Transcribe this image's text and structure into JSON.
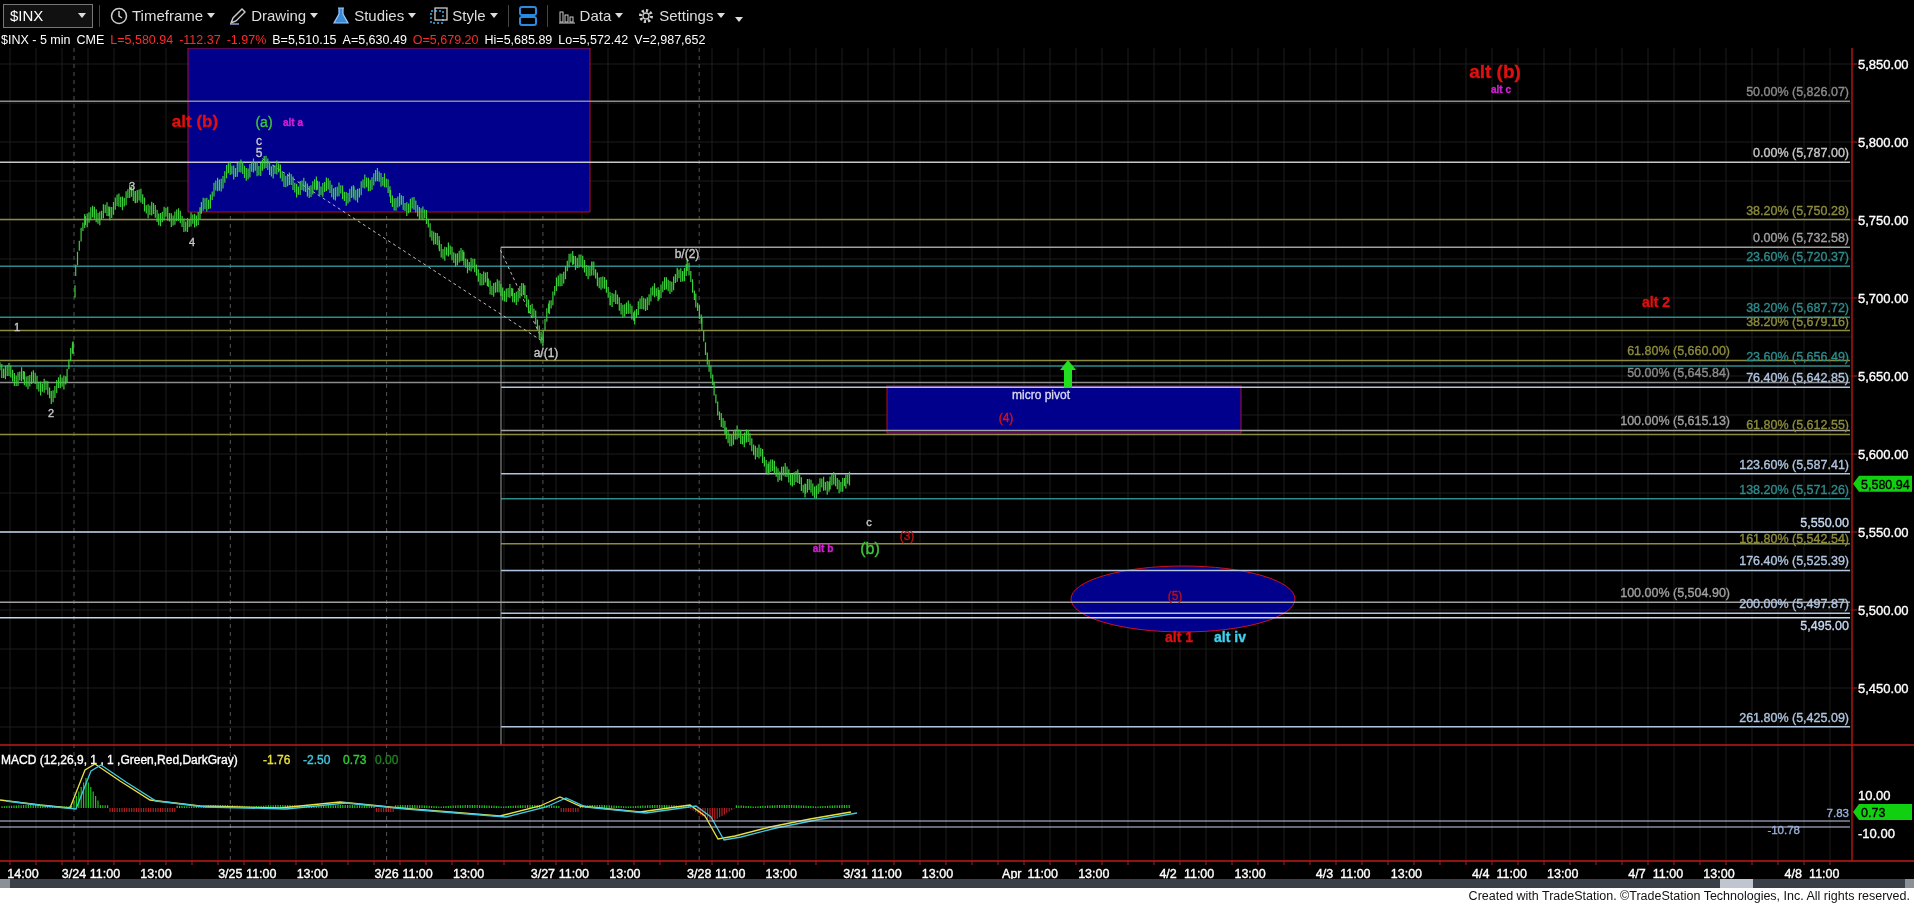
{
  "toolbar": {
    "symbol": "$INX",
    "menus": [
      {
        "kind": "timeframe",
        "label": "Timeframe"
      },
      {
        "kind": "drawing",
        "label": "Drawing"
      },
      {
        "kind": "studies",
        "label": "Studies"
      },
      {
        "kind": "style",
        "label": "Style"
      },
      {
        "kind": "layout"
      },
      {
        "kind": "data",
        "label": "Data"
      },
      {
        "kind": "settings",
        "label": "Settings"
      }
    ]
  },
  "quote_line": [
    {
      "kind": "plain",
      "text": "$INX - 5 min"
    },
    {
      "kind": "plain",
      "text": "CME"
    },
    {
      "kind": "down",
      "text": "L=5,580.94"
    },
    {
      "kind": "down",
      "text": "-112.37"
    },
    {
      "kind": "down",
      "text": "-1.97%"
    },
    {
      "kind": "plain",
      "text": "B=5,510.15"
    },
    {
      "kind": "plain",
      "text": "A=5,630.49"
    },
    {
      "kind": "down",
      "text": "O=5,679.20"
    },
    {
      "kind": "plain",
      "text": "Hi=5,685.89"
    },
    {
      "kind": "plain",
      "text": "Lo=5,572.42"
    },
    {
      "kind": "plain",
      "text": "V=2,987,652"
    }
  ],
  "price_axis": {
    "ticks": [
      "5,850.00",
      "5,800.00",
      "5,750.00",
      "5,700.00",
      "5,650.00",
      "5,600.00",
      "5,550.00",
      "5,500.00",
      "5,450.00"
    ],
    "last_price": "5,580.94"
  },
  "fib_levels": [
    {
      "label": "50.00% (5,826.07)",
      "color": "#8c8c8c"
    },
    {
      "label": "0.00% (5,787.00)",
      "color": "#c8c8c8"
    },
    {
      "label": "38.20% (5,750.28)",
      "color": "#8c8c3c"
    },
    {
      "label": "0.00% (5,732.58)",
      "color": "#a0a0a0"
    },
    {
      "label": "23.60% (5,720.37)",
      "color": "#2e8b8b"
    },
    {
      "label": "38.20% (5,687.72)",
      "color": "#2e8b8b"
    },
    {
      "label": "38.20% (5,679.16)",
      "color": "#8c8c3c"
    },
    {
      "label": "61.80% (5,660.00)",
      "color": "#8c8c3c"
    },
    {
      "label": "23.60% (5,656.49)",
      "color": "#2e8b8b"
    },
    {
      "label": "50.00% (5,645.84)",
      "color": "#8c8c8c"
    },
    {
      "label": "76.40% (5,642.85)",
      "color": "#b0c4de"
    },
    {
      "label": "100.00% (5,615.13)",
      "color": "#a0a0a0"
    },
    {
      "label": "61.80% (5,612.55)",
      "color": "#8c8c3c"
    },
    {
      "label": "123.60% (5,587.41)",
      "color": "#b0c4de"
    },
    {
      "label": "138.20% (5,571.26)",
      "color": "#2e8b8b"
    },
    {
      "label": "5,550.00"
    },
    {
      "label": "161.80% (5,542.54)",
      "color": "#8c8c3c"
    },
    {
      "label": "176.40% (5,525.39)",
      "color": "#b0c4de"
    },
    {
      "label": "100.00% (5,504.90)",
      "color": "#a0a0a0"
    },
    {
      "label": "200.00% (5,497.87)",
      "color": "#b0c4de"
    },
    {
      "label": "5,495.00"
    },
    {
      "label": "261.80% (5,425.09)",
      "color": "#b0c4de"
    }
  ],
  "annotations": [
    {
      "text": "alt (b)",
      "color": "#e01010"
    },
    {
      "text": "(a)",
      "color": "#3cc83c"
    },
    {
      "text": "alt a",
      "color": "#d020d0"
    },
    {
      "text": "c",
      "color": "#c8c8c8"
    },
    {
      "text": "5",
      "color": "#c8c8c8"
    },
    {
      "text": "3",
      "color": "#c8c8c8"
    },
    {
      "text": "4",
      "color": "#c8c8c8"
    },
    {
      "text": "1",
      "color": "#c8c8c8"
    },
    {
      "text": "2",
      "color": "#c8c8c8"
    },
    {
      "text": "a/(1)",
      "color": "#c8c8c8"
    },
    {
      "text": "b/(2)",
      "color": "#c8c8c8"
    },
    {
      "text": "micro pivot",
      "color": "#d8d8f0"
    },
    {
      "text": "(4)",
      "color": "#e01010"
    },
    {
      "text": "alt b",
      "color": "#d020d0"
    },
    {
      "text": "c",
      "color": "#c8c8c8"
    },
    {
      "text": "(b)",
      "color": "#3cc83c"
    },
    {
      "text": "(3)",
      "color": "#c01010"
    },
    {
      "text": "(5)",
      "color": "#c01010"
    },
    {
      "text": "alt 1",
      "color": "#e01010"
    },
    {
      "text": "alt iv",
      "color": "#40d0f0"
    },
    {
      "text": "alt (b)",
      "color": "#e01010"
    },
    {
      "text": "alt c",
      "color": "#d020d0"
    },
    {
      "text": "alt 2",
      "color": "#e01010"
    }
  ],
  "macd": {
    "title": "MACD (12,26,9, 1 , 1 ,Green,Red,DarkGray)",
    "values": [
      {
        "text": "-1.76",
        "color": "#e8e040"
      },
      {
        "text": "-2.50",
        "color": "#40c8e0"
      },
      {
        "text": "0.73",
        "color": "#30d030"
      },
      {
        "text": "0.00",
        "color": "#208020"
      }
    ],
    "line_labels": [
      "7.83",
      "-10.78"
    ],
    "ticks": [
      "10.00",
      "-10.00"
    ],
    "last_value": "0.73"
  },
  "time_axis": {
    "first_label": "14:00",
    "days": [
      {
        "date": "3/24",
        "times": [
          "11:00",
          "13:00"
        ]
      },
      {
        "date": "3/25",
        "times": [
          "11:00",
          "13:00"
        ]
      },
      {
        "date": "3/26",
        "times": [
          "11:00",
          "13:00"
        ]
      },
      {
        "date": "3/27",
        "times": [
          "11:00",
          "13:00"
        ]
      },
      {
        "date": "3/28",
        "times": [
          "11:00",
          "13:00"
        ]
      },
      {
        "date": "3/31",
        "times": [
          "11:00",
          "13:00"
        ]
      },
      {
        "date": "Apr",
        "times": [
          "11:00",
          "13:00"
        ]
      },
      {
        "date": "4/2",
        "times": [
          "11:00",
          "13:00"
        ]
      },
      {
        "date": "4/3",
        "times": [
          "11:00",
          "13:00"
        ]
      },
      {
        "date": "4/4",
        "times": [
          "11:00",
          "13:00"
        ]
      },
      {
        "date": "4/7",
        "times": [
          "11:00",
          "13:00"
        ]
      },
      {
        "date": "4/8",
        "times": [
          "11:00"
        ]
      }
    ]
  },
  "footer": "Created with TradeStation. ©TradeStation Technologies, Inc. All rights reserved."
}
